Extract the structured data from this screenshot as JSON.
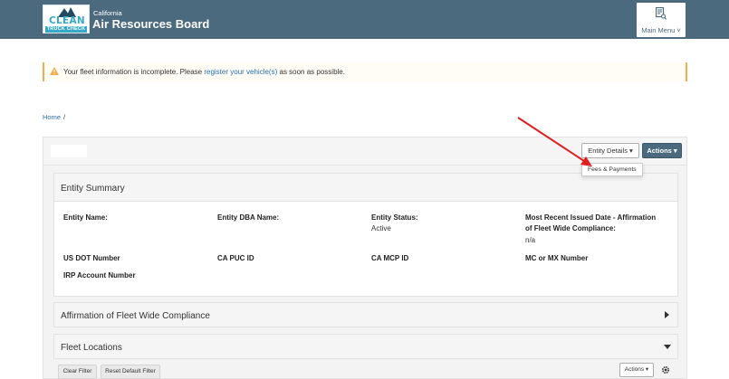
{
  "header": {
    "logo": {
      "word": "CLEAN",
      "tagline": "TRUCK CHECK"
    },
    "org_small": "California",
    "org_name": "Air Resources Board",
    "main_menu_label": "Main Menu ˅"
  },
  "alert": {
    "text_before": "Your fleet information is incomplete. Please ",
    "link_text": "register your vehicle(s)",
    "text_after": " as soon as possible."
  },
  "breadcrumb": {
    "home": "Home",
    "separator": "/"
  },
  "toolbar": {
    "entity_details_label": "Entity Details ▾",
    "actions_label": "Actions ▾",
    "dropdown_item": "Fees & Payments"
  },
  "summary": {
    "title": "Entity Summary",
    "entity_name_label": "Entity Name:",
    "entity_dba_label": "Entity DBA Name:",
    "entity_status_label": "Entity Status:",
    "entity_status_value": "Active",
    "recent_date_label_1": "Most Recent Issued Date - Affirmation",
    "recent_date_label_2": "of Fleet Wide Compliance:",
    "recent_date_value": "n/a",
    "usdot_label": "US DOT Number",
    "capuc_label": "CA PUC ID",
    "camcp_label": "CA MCP ID",
    "mcmx_label": "MC or MX Number",
    "irp_label": "IRP Account Number"
  },
  "affirmation": {
    "title": "Affirmation of Fleet Wide Compliance"
  },
  "locations": {
    "title": "Fleet Locations",
    "clear_filter": "Clear Filter",
    "reset_filter": "Reset Default Filter",
    "actions_label": "Actions ▾"
  },
  "colors": {
    "header_bg": "#4b6a7e",
    "accent_link": "#2a6fb1",
    "warning": "#f0ad4e",
    "annotation_arrow": "#e02020"
  }
}
